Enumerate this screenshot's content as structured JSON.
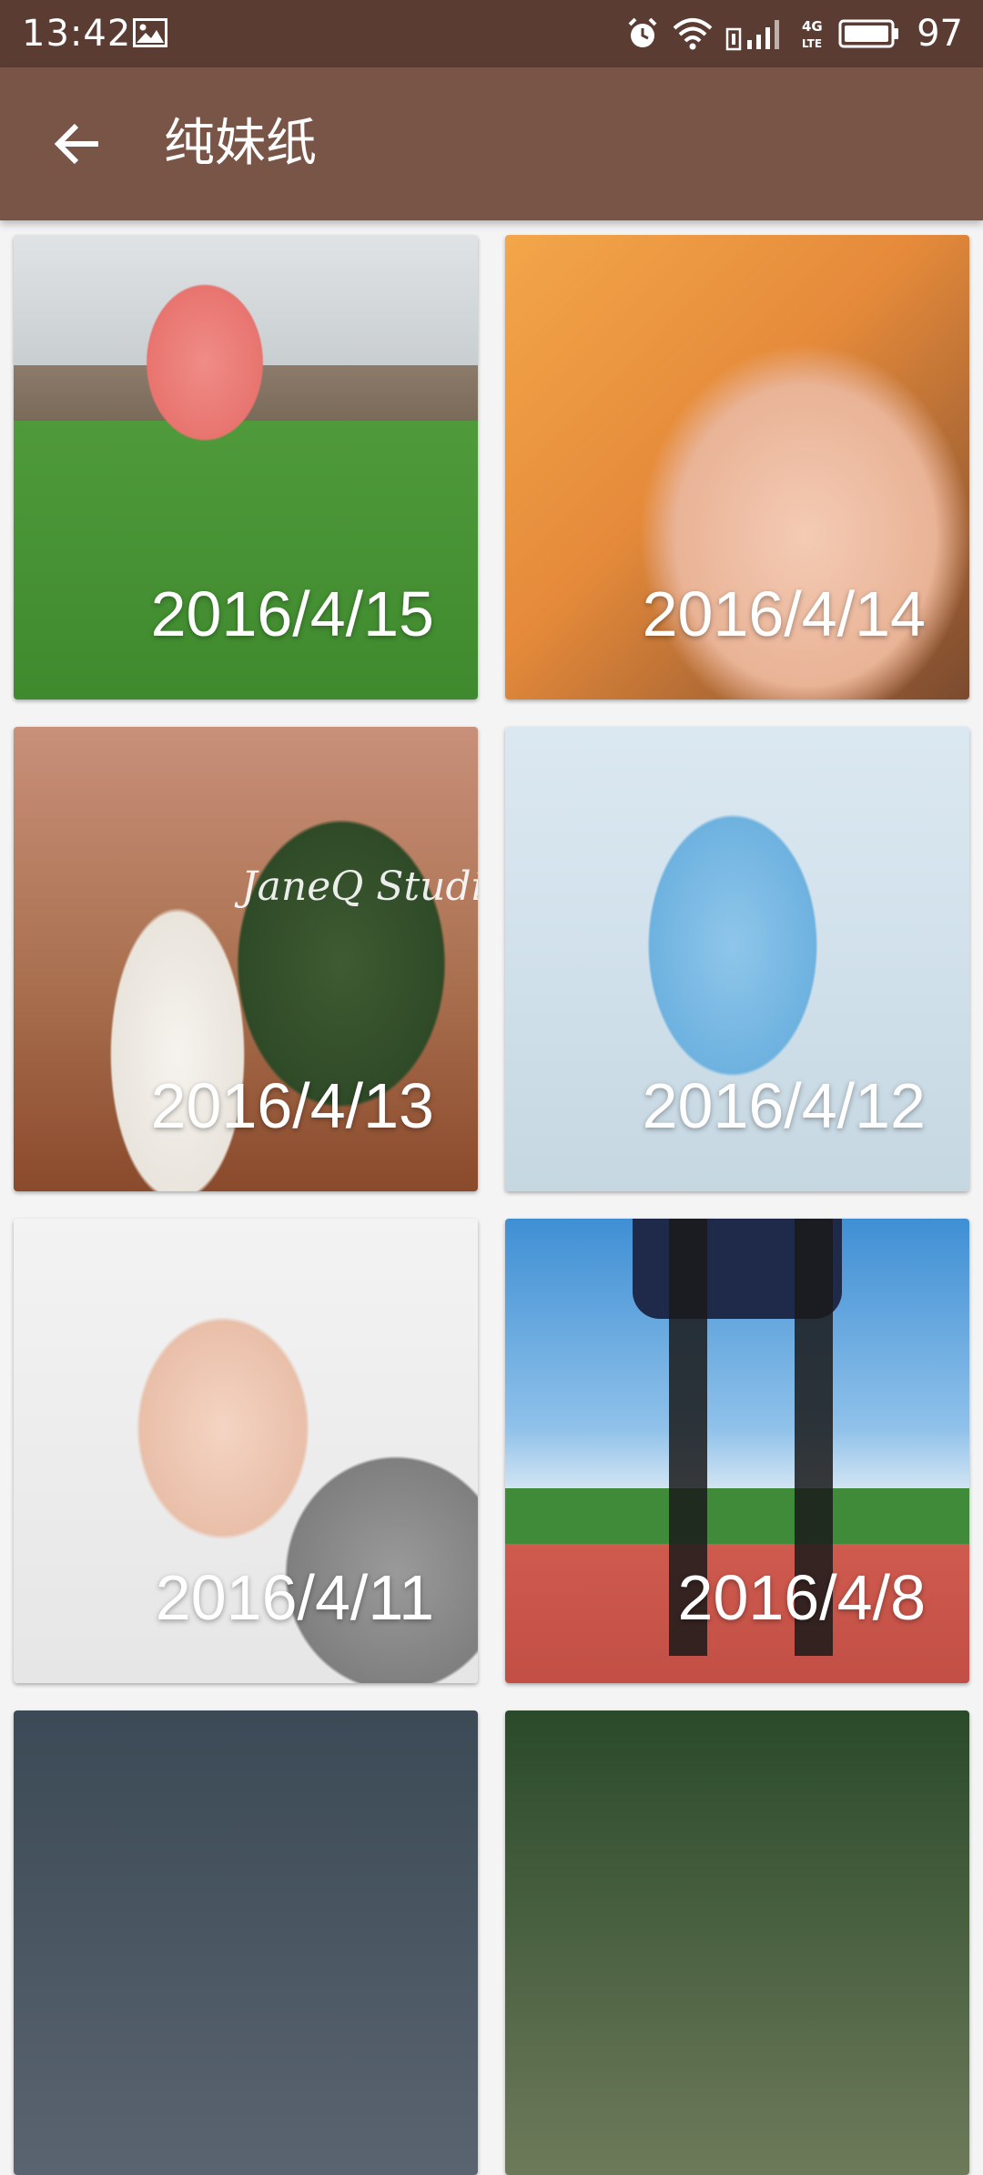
{
  "status_bar": {
    "time": "13:42",
    "battery_level": "97",
    "icons": [
      "gallery-icon",
      "alarm-icon",
      "wifi-icon",
      "signal-icon",
      "lte-icon",
      "battery-icon"
    ]
  },
  "app_bar": {
    "back_icon": "arrow-left-icon",
    "title": "纯妹纸"
  },
  "colors": {
    "status_bar": "#5b3c33",
    "app_bar": "#795548",
    "background": "#f4f4f4"
  },
  "grid": {
    "items": [
      {
        "date": "2016/4/15"
      },
      {
        "date": "2016/4/14"
      },
      {
        "date": "2016/4/13",
        "watermark": "JaneQ Studio"
      },
      {
        "date": "2016/4/12"
      },
      {
        "date": "2016/4/11"
      },
      {
        "date": "2016/4/8"
      },
      {
        "date": ""
      },
      {
        "date": ""
      }
    ]
  }
}
